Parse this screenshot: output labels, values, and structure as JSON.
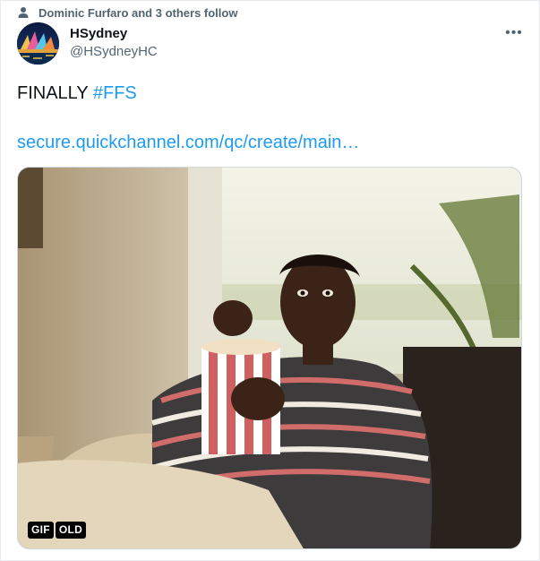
{
  "social_context": {
    "text": "Dominic Furfaro and 3 others follow",
    "icon": "person-icon"
  },
  "author": {
    "display_name": "HSydney",
    "handle": "@HSydneyHC",
    "avatar_icon": "opera-house-avatar"
  },
  "more_menu": {
    "icon": "ellipsis-icon",
    "label": "•••"
  },
  "tweet": {
    "text": "FINALLY",
    "hashtag": "#FFS",
    "link_text": "secure.quickchannel.com/qc/create/main…"
  },
  "media": {
    "type": "gif",
    "badges": [
      "GIF",
      "OLD"
    ]
  },
  "colors": {
    "link": "#1d9bf0",
    "secondary_text": "#536471",
    "primary_text": "#0f1419"
  }
}
